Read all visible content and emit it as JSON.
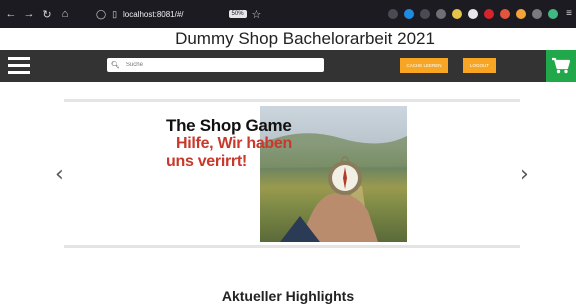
{
  "browser": {
    "url": "localhost:8081/#/",
    "zoom": "50%",
    "nav": [
      "←",
      "→",
      "↻",
      "⌂"
    ]
  },
  "site": {
    "title": "Dummy Shop Bachelorarbeit 2021"
  },
  "nav": {
    "search_placeholder": "Suche",
    "btn_cache": "CACHE LEEREN",
    "btn_logout": "LOGOUT"
  },
  "carousel": {
    "banner_title": "The Shop Game",
    "banner_line1": "Hilfe, Wir haben",
    "banner_line2": "uns verirrt!",
    "prev": "‹",
    "next": "›"
  },
  "section": {
    "heading": "Aktueller Highlights"
  },
  "colors": {
    "nav_bg": "#333333",
    "accent_orange": "#f6a623",
    "cart_green": "#20a84a",
    "banner_red": "#c9382a"
  }
}
